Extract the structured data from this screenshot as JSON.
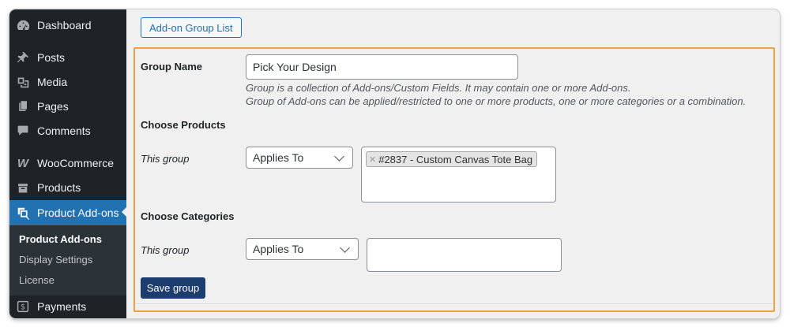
{
  "sidebar": {
    "items": [
      {
        "label": "Dashboard",
        "icon": "dashboard-icon"
      },
      {
        "label": "Posts",
        "icon": "pin-icon"
      },
      {
        "label": "Media",
        "icon": "media-icon"
      },
      {
        "label": "Pages",
        "icon": "pages-icon"
      },
      {
        "label": "Comments",
        "icon": "comment-icon"
      },
      {
        "label": "WooCommerce",
        "icon": "woo-icon"
      },
      {
        "label": "Products",
        "icon": "archive-icon"
      },
      {
        "label": "Product Add-ons",
        "icon": "addons-icon",
        "active": true
      },
      {
        "label": "Payments",
        "icon": "dollar-icon"
      }
    ],
    "submenu": [
      "Product Add-ons",
      "Display Settings",
      "License"
    ],
    "active_color": "#2271b1"
  },
  "header": {
    "list_button": "Add-on Group List"
  },
  "form": {
    "group_name_label": "Group Name",
    "group_name_value": "Pick Your Design",
    "desc_line1": "Group is a collection of Add-ons/Custom Fields. It may contain one or more Add-ons.",
    "desc_line2": "Group of Add-ons can be applied/restricted to one or more products, one or more categories or a combination.",
    "choose_products_label": "Choose Products",
    "products_row_label": "This group",
    "products_select": "Applies To",
    "products_token": "#2837 - Custom Canvas Tote Bag",
    "choose_categories_label": "Choose Categories",
    "categories_row_label": "This group",
    "categories_select": "Applies To",
    "save_label": "Save group"
  },
  "colors": {
    "highlight_border": "#f0a03c",
    "primary_button": "#1d3d6e"
  }
}
